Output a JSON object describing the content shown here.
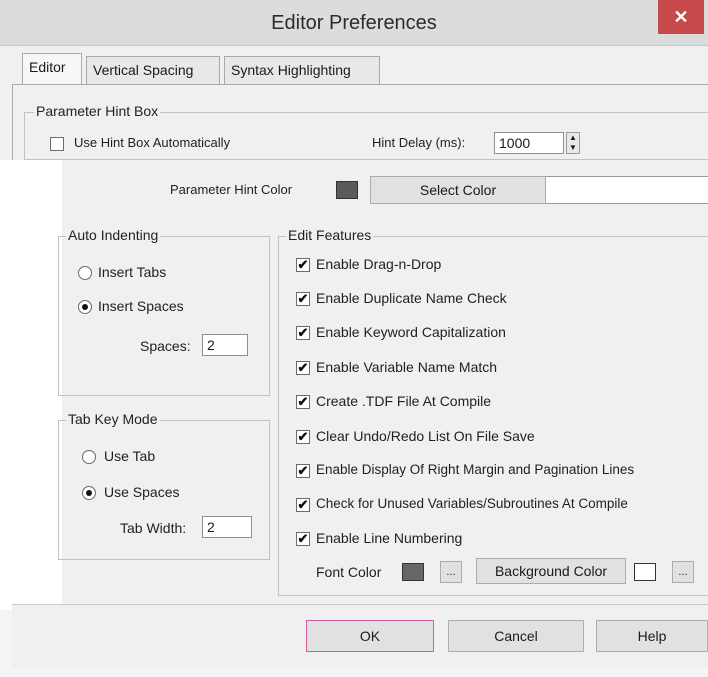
{
  "window": {
    "title": "Editor Preferences",
    "close_glyph": "✕"
  },
  "tabs": [
    {
      "label": "Editor",
      "active": true
    },
    {
      "label": "Vertical Spacing",
      "active": false
    },
    {
      "label": "Syntax Highlighting",
      "active": false
    }
  ],
  "parameter_hint_box": {
    "group_label": "Parameter Hint Box",
    "show_label": "Use Hint Box Automatically",
    "delay_label": "Hint Delay (ms):",
    "delay_value": "1000",
    "color_label": "Parameter Hint Color",
    "select_color_label": "Select Color",
    "color_value": "#5a5a5a"
  },
  "auto_indenting": {
    "group_label": "Auto Indenting",
    "options": [
      {
        "label": "Insert Tabs",
        "checked": false
      },
      {
        "label": "Insert Spaces",
        "checked": true
      }
    ],
    "spaces_label": "Spaces:",
    "spaces_value": "2"
  },
  "tab_key_mode": {
    "group_label": "Tab Key Mode",
    "options": [
      {
        "label": "Use Tab",
        "checked": false
      },
      {
        "label": "Use Spaces",
        "checked": true
      }
    ],
    "width_label": "Tab Width:",
    "width_value": "2"
  },
  "edit_features": {
    "group_label": "Edit Features",
    "items": [
      {
        "label": "Enable Drag-n-Drop",
        "checked": true
      },
      {
        "label": "Enable Duplicate Name Check",
        "checked": true
      },
      {
        "label": "Enable Keyword Capitalization",
        "checked": true
      },
      {
        "label": "Enable Variable Name Match",
        "checked": true
      },
      {
        "label": "Create .TDF File At Compile",
        "checked": true
      },
      {
        "label": "Clear Undo/Redo List On File Save",
        "checked": true
      },
      {
        "label": "Enable Display Of Right Margin and Pagination Lines",
        "checked": true
      },
      {
        "label": "Check for Unused Variables/Subroutines At Compile",
        "checked": true
      },
      {
        "label": "Enable Line Numbering",
        "checked": true
      }
    ],
    "font_color_label": "Font Color",
    "background_color_label": "Background Color",
    "ellipsis": "...",
    "font_color_value": "#666666",
    "background_color_value": "#ffffff"
  },
  "buttons": {
    "ok": "OK",
    "cancel": "Cancel",
    "help": "Help"
  }
}
